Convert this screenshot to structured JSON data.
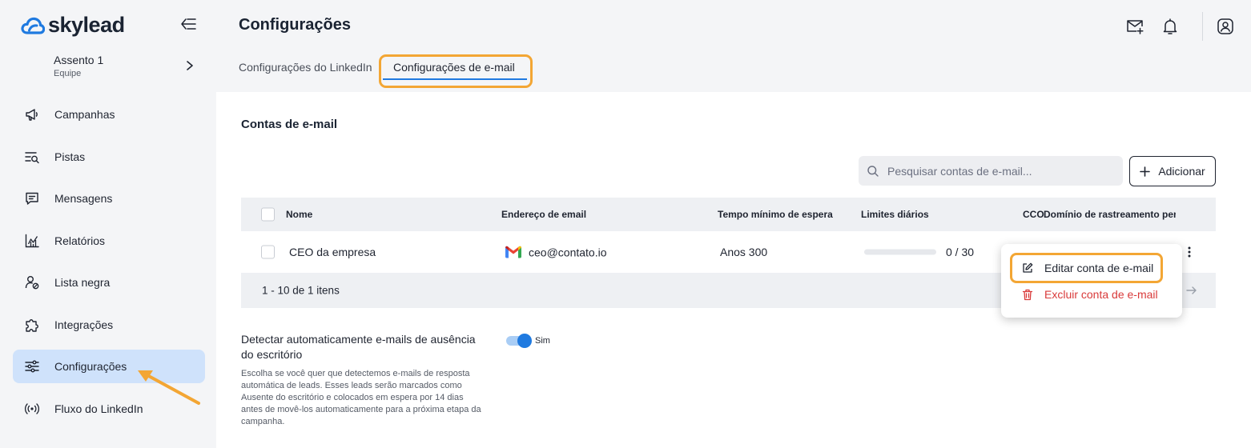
{
  "brand": {
    "logo_text": "skylead",
    "accent": "#1f7ae0",
    "highlight": "#f3a634"
  },
  "seat": {
    "name": "Assento 1",
    "team": "Equipe"
  },
  "sidebar": {
    "items": [
      {
        "label": "Campanhas",
        "icon": "megaphone-icon"
      },
      {
        "label": "Pistas",
        "icon": "lead-search-icon"
      },
      {
        "label": "Mensagens",
        "icon": "message-icon"
      },
      {
        "label": "Relatórios",
        "icon": "chart-icon"
      },
      {
        "label": "Lista negra",
        "icon": "blocked-user-icon"
      },
      {
        "label": "Integrações",
        "icon": "puzzle-icon"
      },
      {
        "label": "Configurações",
        "icon": "sliders-icon",
        "active": true
      },
      {
        "label": "Fluxo do LinkedIn",
        "icon": "broadcast-icon"
      }
    ]
  },
  "header": {
    "title": "Configurações",
    "icons": [
      "mail-plus-icon",
      "bell-icon",
      "user-circle-icon"
    ]
  },
  "tabs": [
    {
      "label": "Configurações do LinkedIn"
    },
    {
      "label": "Configurações de e-mail",
      "active": true
    }
  ],
  "email_accounts": {
    "title": "Contas de e-mail",
    "search_placeholder": "Pesquisar contas de e-mail...",
    "add_label": "Adicionar",
    "columns": [
      "Nome",
      "Endereço de email",
      "Tempo mínimo de espera",
      "Limites diários",
      "CCO",
      "Domínio de rastreamento pers"
    ],
    "rows": [
      {
        "name": "CEO da empresa",
        "email": "ceo@contato.io",
        "wait": "Anos 300",
        "limit_text": "0 / 30",
        "limit_fraction": 0
      }
    ],
    "pagination": "1 - 10 de 1 itens"
  },
  "context_menu": {
    "edit_label": "Editar conta de e-mail",
    "delete_label": "Excluir conta de e-mail"
  },
  "out_of_office": {
    "title": "Detectar automaticamente e-mails de ausência do escritório",
    "description": "Escolha se você quer que detectemos e-mails de resposta automática de leads. Esses leads serão marcados como Ausente do escritório e colocados em espera por 14 dias antes de movê-los automaticamente para a próxima etapa da campanha.",
    "toggle_label": "Sim",
    "enabled": true
  }
}
